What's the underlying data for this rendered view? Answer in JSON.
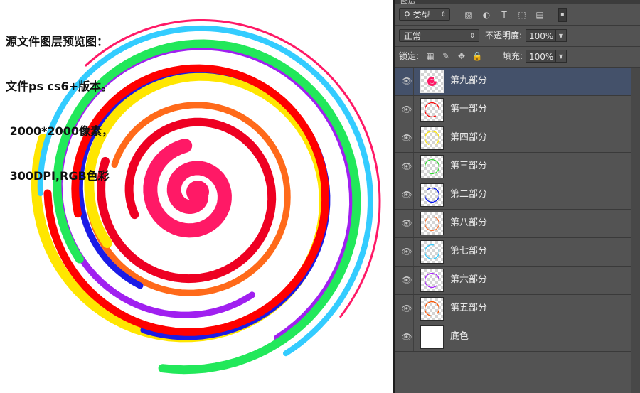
{
  "caption": {
    "lines": [
      "源文件图层预览图：",
      "文件ps cs6+版本。",
      " 2000*2000像素，",
      " 300DPI,RGB色彩"
    ]
  },
  "panel": {
    "tab_label": "图层",
    "filter": {
      "icon": "search-icon",
      "label": "类型"
    },
    "filter_icons": [
      "image-filter-icon",
      "adjustment-filter-icon",
      "text-filter-icon",
      "shape-filter-icon",
      "smart-object-filter-icon",
      "filter-toggle-icon"
    ],
    "blend_mode": "正常",
    "opacity_label": "不透明度:",
    "opacity_value": "100%",
    "lock_label": "锁定:",
    "lock_icons": [
      "lock-transparent-icon",
      "lock-paint-icon",
      "lock-move-icon",
      "lock-all-icon"
    ],
    "fill_label": "填充:",
    "fill_value": "100%"
  },
  "layers": [
    {
      "name": "第九部分",
      "active": true,
      "thumb_color": "#ff1966"
    },
    {
      "name": "第一部分",
      "active": false,
      "thumb_color": "#ff0000"
    },
    {
      "name": "第四部分",
      "active": false,
      "thumb_color": "#ffe600"
    },
    {
      "name": "第三部分",
      "active": false,
      "thumb_color": "#33dd33"
    },
    {
      "name": "第二部分",
      "active": false,
      "thumb_color": "#0011ee"
    },
    {
      "name": "第八部分",
      "active": false,
      "thumb_color": "#ff7733"
    },
    {
      "name": "第七部分",
      "active": false,
      "thumb_color": "#33ccff"
    },
    {
      "name": "第六部分",
      "active": false,
      "thumb_color": "#aa22ff"
    },
    {
      "name": "第五部分",
      "active": false,
      "thumb_color": "#ff5500"
    },
    {
      "name": "底色",
      "active": false,
      "thumb_color": "#ffffff"
    }
  ],
  "colors": {
    "panel_bg": "#535353",
    "selected_layer": "#44516a",
    "spiral": [
      "#ff1966",
      "#ee0022",
      "#ff6a1a",
      "#ffe600",
      "#1b1be6",
      "#a020f0",
      "#22e85a",
      "#33ccff",
      "#ff0000"
    ]
  }
}
